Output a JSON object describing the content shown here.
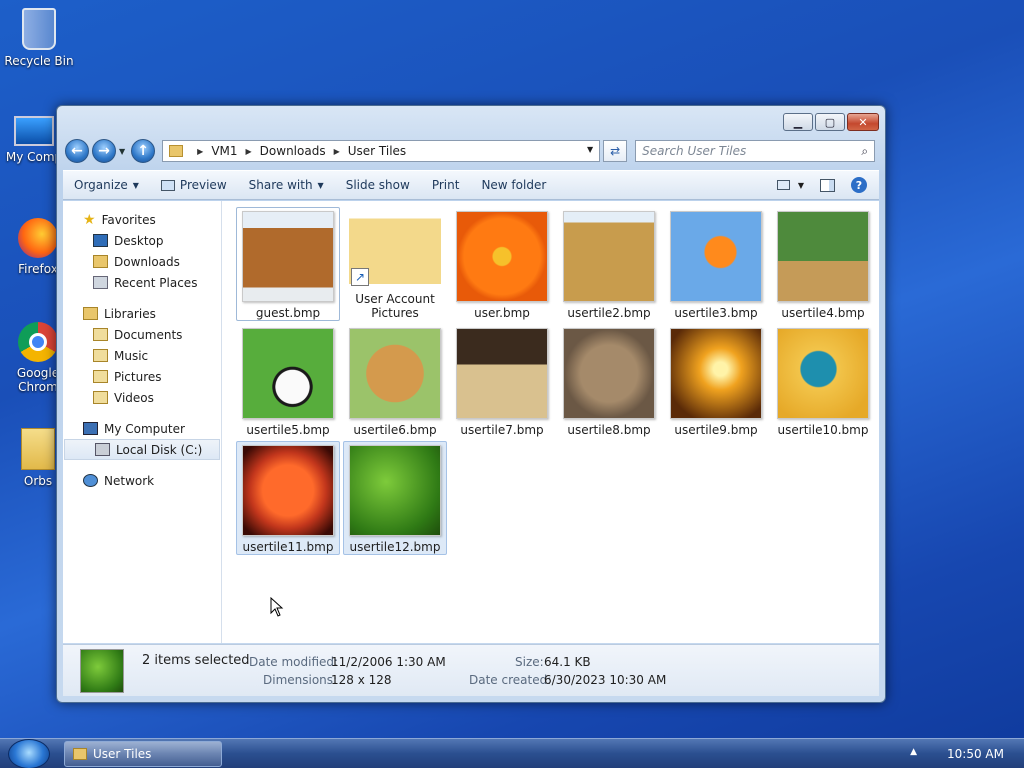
{
  "desktop": {
    "icons": [
      {
        "label": "Recycle Bin"
      },
      {
        "label": "My Comp"
      },
      {
        "label": "Firefox"
      },
      {
        "label": "Google Chrom"
      },
      {
        "label": "Orbs"
      }
    ]
  },
  "window": {
    "address": {
      "crumbs": [
        "VM1",
        "Downloads",
        "User Tiles"
      ]
    },
    "search": {
      "placeholder": "Search User Tiles"
    },
    "toolbar": {
      "organize": "Organize",
      "preview": "Preview",
      "share": "Share with",
      "slideshow": "Slide show",
      "print": "Print",
      "newfolder": "New folder"
    },
    "nav": {
      "favorites": "Favorites",
      "desktop": "Desktop",
      "downloads": "Downloads",
      "recent": "Recent Places",
      "libraries": "Libraries",
      "documents": "Documents",
      "music": "Music",
      "pictures": "Pictures",
      "videos": "Videos",
      "mycomputer": "My Computer",
      "localdisk": "Local Disk (C:)",
      "network": "Network"
    },
    "files": [
      {
        "name": "guest.bmp"
      },
      {
        "name": "User Account Pictures"
      },
      {
        "name": "user.bmp"
      },
      {
        "name": "usertile2.bmp"
      },
      {
        "name": "usertile3.bmp"
      },
      {
        "name": "usertile4.bmp"
      },
      {
        "name": "usertile5.bmp"
      },
      {
        "name": "usertile6.bmp"
      },
      {
        "name": "usertile7.bmp"
      },
      {
        "name": "usertile8.bmp"
      },
      {
        "name": "usertile9.bmp"
      },
      {
        "name": "usertile10.bmp"
      },
      {
        "name": "usertile11.bmp"
      },
      {
        "name": "usertile12.bmp"
      }
    ],
    "details": {
      "selected": "2 items selected",
      "date_modified_label": "Date modified:",
      "date_modified": "11/2/2006 1:30 AM",
      "dimensions_label": "Dimensions:",
      "dimensions": "128 x 128",
      "size_label": "Size:",
      "size": "64.1 KB",
      "date_created_label": "Date created:",
      "date_created": "6/30/2023 10:30 AM"
    }
  },
  "taskbar": {
    "task_label": "User Tiles",
    "time": "10:50 AM"
  }
}
